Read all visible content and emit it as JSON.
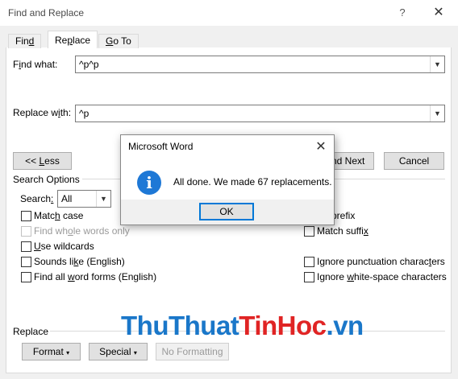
{
  "window": {
    "title": "Find and Replace",
    "help": "?",
    "close": "✕"
  },
  "tabs": [
    {
      "label": "Find",
      "mnemonic": "d",
      "pre": "Fin",
      "post": ""
    },
    {
      "label": "Replace",
      "mnemonic": "p",
      "pre": "Re",
      "post": "lace"
    },
    {
      "label": "Go To",
      "mnemonic": "G",
      "pre": "",
      "post": "o To"
    }
  ],
  "find": {
    "label_pre": "F",
    "label_mn": "i",
    "label_post": "nd what:",
    "value": "^p^p"
  },
  "replace": {
    "label_pre": "Replace w",
    "label_mn": "i",
    "label_post": "th:",
    "value": "^p"
  },
  "buttons": {
    "less": "<< Less",
    "less_mn": "L",
    "less_pre": "<< ",
    "less_post": "ess",
    "find_next": "Find Next",
    "find_next_visible": "nd Next",
    "cancel": "Cancel"
  },
  "search_options": {
    "title": "Search Options",
    "search_label_pre": "Search",
    "search_label_mn": ":",
    "search_value": "All",
    "left": [
      {
        "pre": "Matc",
        "mn": "h",
        "post": " case",
        "disabled": false
      },
      {
        "pre": "Find wh",
        "mn": "o",
        "post": "le words only",
        "disabled": true
      },
      {
        "pre": "",
        "mn": "U",
        "post": "se wildcards",
        "disabled": false
      },
      {
        "pre": "Sounds li",
        "mn": "k",
        "post": "e (English)",
        "disabled": false
      },
      {
        "pre": "Find all ",
        "mn": "w",
        "post": "ord forms (English)",
        "disabled": false
      }
    ],
    "right": [
      {
        "text": "ch prefix"
      },
      {
        "pre": "Match suffi",
        "mn": "x",
        "post": ""
      },
      {
        "pre": "Ignore punctuation charac",
        "mn": "t",
        "post": "ers"
      },
      {
        "pre": "Ignore ",
        "mn": "w",
        "post": "hite-space characters"
      }
    ]
  },
  "replace_section": {
    "title": "Replace",
    "format": "Format",
    "format_mn": "o",
    "special": "Special",
    "special_mn": "e",
    "no_formatting": "No Formatting"
  },
  "dialog": {
    "title": "Microsoft Word",
    "icon": "info-icon",
    "icon_glyph": "i",
    "message": "All done. We made 67 replacements.",
    "ok": "OK",
    "close": "✕"
  },
  "watermark": {
    "part1": "ThuThuat",
    "part2": "TinHoc",
    "part3": ".vn"
  },
  "colors": {
    "accent": "#0078d7",
    "info": "#1e78d6",
    "wm_blue": "#1a77c9",
    "wm_red": "#e02424"
  }
}
